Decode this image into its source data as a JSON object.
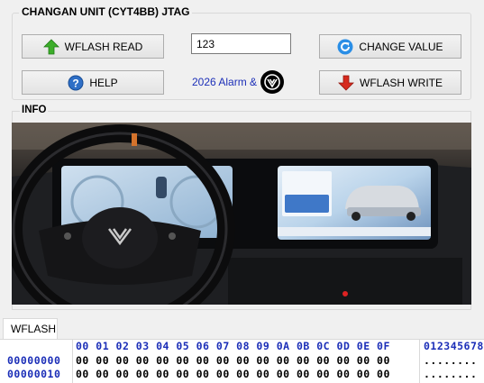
{
  "window": {
    "group_title": "CHANGAN UNIT (CYT4BB) JTAG"
  },
  "toolbar": {
    "wflash_read": "WFLASH READ",
    "help": "HELP",
    "change_value": "CHANGE VALUE",
    "wflash_write": "WFLASH WRITE",
    "value_input": "123",
    "alarm_text": "2026 Alarm &"
  },
  "info": {
    "title": "INFO"
  },
  "tabs": {
    "wflash": "WFLASH"
  },
  "hex": {
    "header": "00 01 02 03 04 05 06 07 08 09 0A 0B 0C 0D 0E 0F",
    "ascii_header": "012345678",
    "rows": [
      {
        "addr": "00000000",
        "bytes": "00 00 00 00 00 00 00 00 00 00 00 00 00 00 00 00",
        "ascii": "........"
      },
      {
        "addr": "00000010",
        "bytes": "00 00 00 00 00 00 00 00 00 00 00 00 00 00 00 00",
        "ascii": "........"
      }
    ]
  },
  "colors": {
    "accent_blue": "#1c2fb8",
    "arrow_green": "#3cae2a",
    "arrow_red": "#d62a1e",
    "help_blue": "#2f6fc6"
  }
}
